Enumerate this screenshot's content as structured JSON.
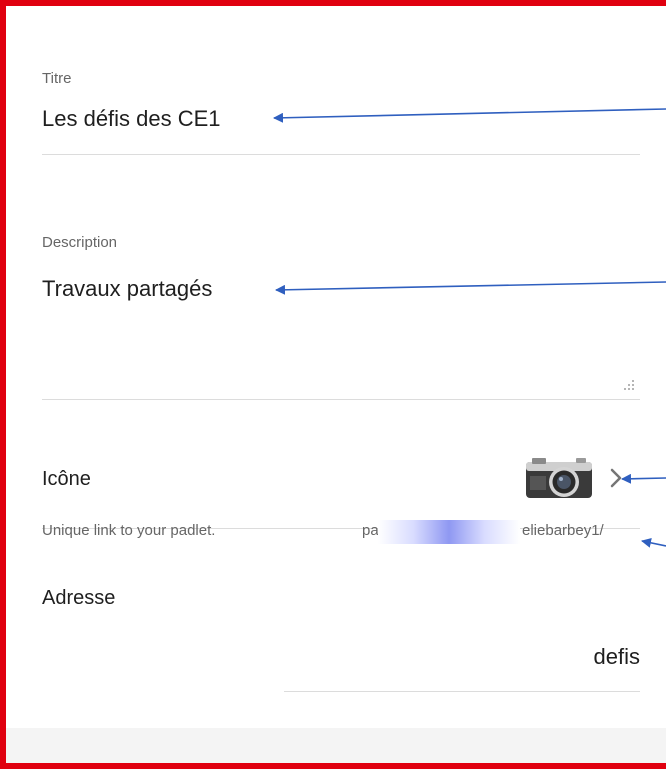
{
  "form": {
    "title_label": "Titre",
    "title_value": "Les défis des CE1",
    "description_label": "Description",
    "description_value": "Travaux partagés",
    "icon_label": "Icône",
    "address_label": "Adresse",
    "address_hint": "Unique link to your padlet.",
    "address_prefix_start": "pa",
    "address_prefix_end": "eliebarbey1/",
    "address_slug": "defis"
  },
  "icons": {
    "selected_icon": "camera-icon",
    "chevron": "chevron-right-icon",
    "resize": "resize-grip-icon"
  },
  "colors": {
    "frame_border": "#e0000f",
    "annotation_arrow": "#2f5fbf",
    "redaction": "#8f98f2"
  }
}
